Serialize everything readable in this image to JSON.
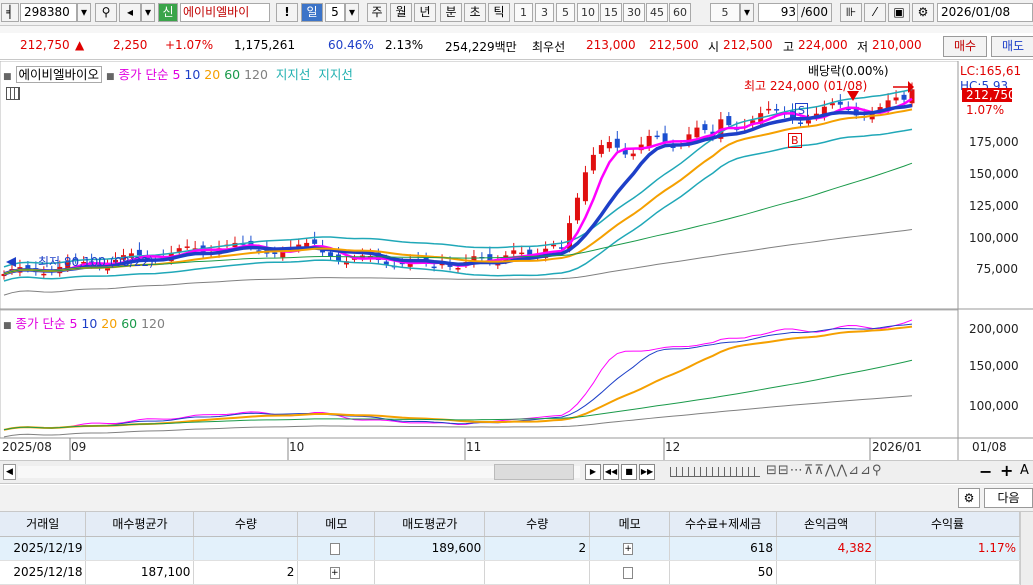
{
  "toolbar": {
    "code": "298380",
    "credit_badge": "신",
    "stock_name": "에이비엘바이",
    "excl": "!",
    "period_day": "일",
    "period_num": "5",
    "period_week": "주",
    "period_month": "월",
    "period_year": "년",
    "period_min": "분",
    "period_sec": "초",
    "period_tick": "틱",
    "intervals": [
      "1",
      "3",
      "5",
      "10",
      "15",
      "30",
      "45",
      "60"
    ],
    "count": "5",
    "page": "93",
    "page_total": "/600",
    "date": "2026/01/08"
  },
  "quote": {
    "price": "212,750",
    "change": "2,250",
    "change_pct": "+1.07%",
    "volume": "1,175,261",
    "turnover_pct": "60.46%",
    "volume_ratio": "2.13%",
    "amount": "254,229백만",
    "best_ask_label": "최우선",
    "best_ask": "213,000",
    "best_bid": "212,500",
    "open_label": "시",
    "open": "212,500",
    "high_label": "고",
    "high": "224,000",
    "low_label": "저",
    "low": "210,000",
    "buy_btn": "매수",
    "sell_btn": "매도"
  },
  "price_panel": {
    "legend_name": "에이비엘바이오",
    "legend_title": "종가 단순",
    "ma_labels": [
      "5",
      "10",
      "20",
      "60",
      "120"
    ],
    "ma_colors": [
      "#ff00ff",
      "#1d3fc8",
      "#f5a000",
      "#1a9a4a",
      "#808080"
    ],
    "support_label": "지지선",
    "resist_label": "지지선",
    "dividend_note": "배당락(0.00%)",
    "high_note": "최고 224,000 (01/08)",
    "low_note": "최저 80,100 (08/22)",
    "lc_label": "LC:165,61",
    "hc_label": "HC:",
    "hc_value": "5,93",
    "current_price_tag": "212,750",
    "current_pct_tag": "1.07%",
    "y_ticks": [
      "175,000",
      "150,000",
      "125,000",
      "100,000",
      "75,000"
    ],
    "marker_s": "S",
    "marker_b": "B"
  },
  "ma_panel": {
    "legend_title": "종가 단순",
    "ma_labels": [
      "5",
      "10",
      "20",
      "60",
      "120"
    ],
    "y_ticks": [
      "200,000",
      "150,000",
      "100,000"
    ]
  },
  "x_axis": {
    "labels": [
      "2025/08",
      "09",
      "10",
      "11",
      "12",
      "2026/01",
      "01/08"
    ]
  },
  "settings_btn": "다음",
  "table": {
    "headers": [
      "거래일",
      "매수평균가",
      "수량",
      "메모",
      "매도평균가",
      "수량",
      "메모",
      "수수료+제세금",
      "손익금액",
      "수익률"
    ],
    "rows": [
      {
        "date": "2025/12/19",
        "buy_avg": "",
        "buy_qty": "",
        "sell_avg": "189,600",
        "sell_qty": "2",
        "fee": "618",
        "pnl": "4,382",
        "ret": "1.17%"
      },
      {
        "date": "2025/12/18",
        "buy_avg": "187,100",
        "buy_qty": "2",
        "sell_avg": "",
        "sell_qty": "",
        "fee": "50",
        "pnl": "",
        "ret": ""
      }
    ]
  },
  "chart_data": [
    {
      "type": "candlestick",
      "title": "에이비엘바이오",
      "x_range": [
        "2025/08",
        "2026/01/08"
      ],
      "ylim": [
        60000,
        230000
      ],
      "series": [
        {
          "name": "5",
          "values_approx": [
            85000,
            95000,
            98000,
            104000,
            92000,
            85000,
            90000,
            100000,
            98000,
            165000,
            175000,
            180000,
            190000,
            195000,
            188000,
            190000,
            205000
          ]
        },
        {
          "name": "10"
        },
        {
          "name": "20"
        },
        {
          "name": "60"
        },
        {
          "name": "120"
        }
      ],
      "high": 224000,
      "low": 80100,
      "last": 212750
    },
    {
      "type": "line",
      "title": "종가 단순",
      "ylim": [
        75000,
        215000
      ],
      "series": [
        {
          "name": "5"
        },
        {
          "name": "10"
        },
        {
          "name": "20"
        },
        {
          "name": "60"
        },
        {
          "name": "120"
        }
      ]
    }
  ]
}
